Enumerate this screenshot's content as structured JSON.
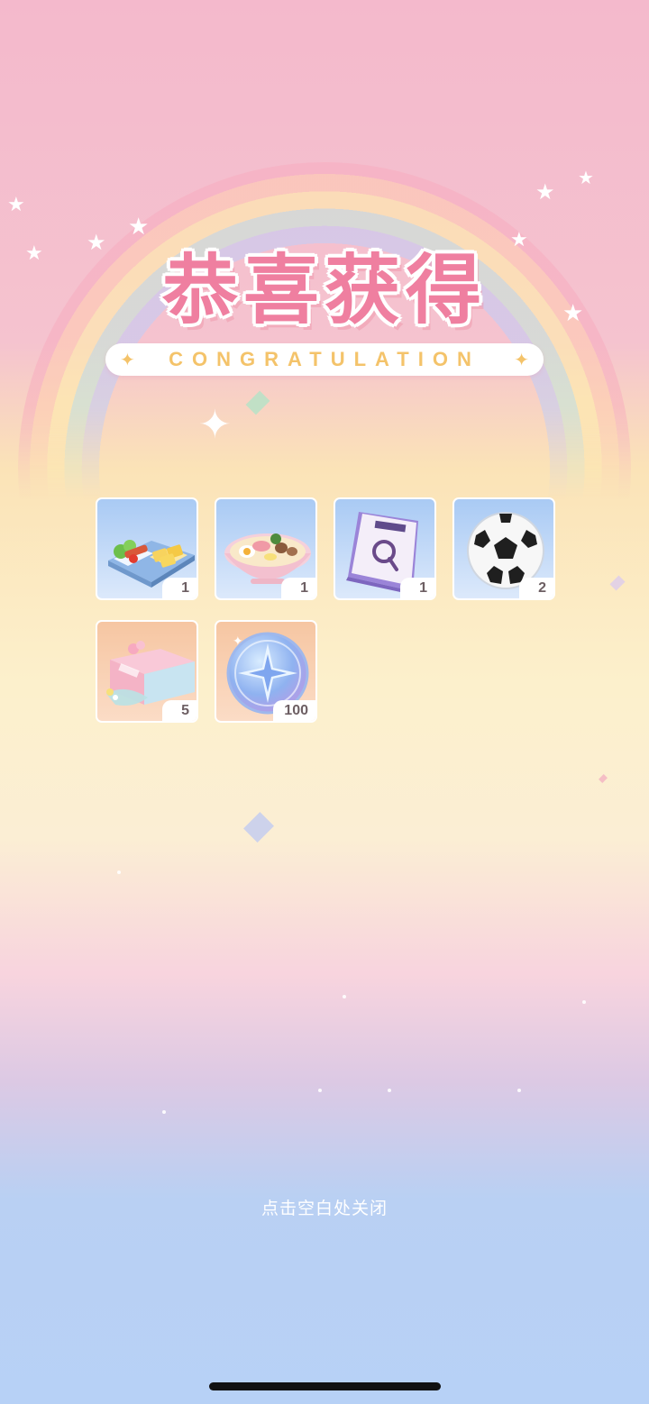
{
  "header": {
    "title": "恭喜获得",
    "subtitle": "CONGRATULATION"
  },
  "rewards": [
    {
      "icon": "bento-box-icon",
      "count": "1"
    },
    {
      "icon": "ramen-bowl-icon",
      "count": "1"
    },
    {
      "icon": "notebook-icon",
      "count": "1"
    },
    {
      "icon": "soccer-ball-icon",
      "count": "2"
    },
    {
      "icon": "gift-box-icon",
      "count": "5"
    },
    {
      "icon": "star-coin-icon",
      "count": "100"
    }
  ],
  "footer": {
    "close_hint": "点击空白处关闭"
  },
  "colors": {
    "title": "#ef7fa0",
    "subtitle": "#f4c36a",
    "count_text": "#6d5f63"
  }
}
